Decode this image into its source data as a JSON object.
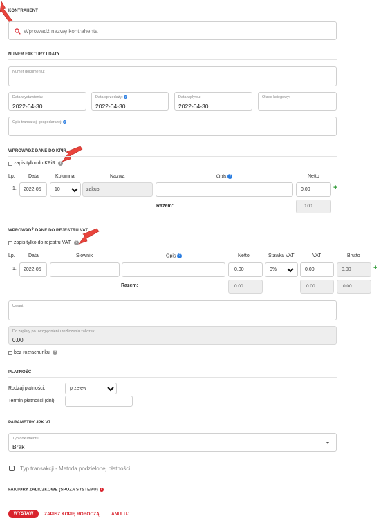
{
  "kontrahent": {
    "section": "KONTRAHENT",
    "search_placeholder": "Wprowadź nazwę kontrahenta"
  },
  "faktura": {
    "section": "NUMER FAKTURY I DATY",
    "numer_label": "Numer dokumentu:",
    "data_wystawienia_label": "Data wystawienia:",
    "data_wystawienia": "2022-04-30",
    "data_sprzedazy_label": "Data sprzedaży:",
    "data_sprzedazy": "2022-04-30",
    "data_wplywu_label": "Data wpływu:",
    "data_wplywu": "2022-04-30",
    "okres_label": "Okres księgowy:",
    "opis_label": "Opis transakcji gospodarczej:"
  },
  "kpir": {
    "section": "WPROWADŹ DANE DO KPIR",
    "checkbox_label": "zapis tylko do KPiR",
    "headers": {
      "lp": "Lp.",
      "data": "Data",
      "kolumna": "Kolumna",
      "nazwa": "Nazwa",
      "opis": "Opis",
      "netto": "Netto"
    },
    "row": {
      "lp": "1.",
      "data": "2022-05",
      "kolumna": "10",
      "nazwa": "zakup",
      "netto": "0.00"
    },
    "razem_label": "Razem:",
    "razem_netto": "0.00"
  },
  "vat": {
    "section": "WPROWADŹ DANE DO REJESTRU VAT",
    "checkbox_label": "zapis tylko do rejestru VAT",
    "headers": {
      "lp": "Lp.",
      "data": "Data",
      "slownik": "Słownik",
      "opis": "Opis",
      "netto": "Netto",
      "stawka": "Stawka VAT",
      "vat": "VAT",
      "brutto": "Brutto"
    },
    "row": {
      "lp": "1.",
      "data": "2022-05",
      "netto": "0.00",
      "stawka": "0%",
      "vat": "0.00",
      "brutto": "0.00"
    },
    "razem_label": "Razem:",
    "razem_netto": "0.00",
    "razem_vat": "0.00",
    "razem_brutto": "0.00"
  },
  "uwagi": {
    "label": "Uwagi:",
    "do_zaplaty_label": "Do zapłaty po uwzględnieniu rozliczenia zaliczek:",
    "do_zaplaty": "0.00",
    "bez_rozrachunku": "bez rozrachunku"
  },
  "platnosc": {
    "section": "PŁATNOŚĆ",
    "rodzaj_label": "Rodzaj płatności:",
    "rodzaj_value": "przelew",
    "termin_label": "Termin płatności (dni):"
  },
  "jpk": {
    "section": "PARAMETRY JPK V7",
    "typ_label": "Typ dokumentu",
    "typ_value": "Brak",
    "mpp_label": "Typ transakcji - Metoda podzielonej płatności"
  },
  "zaliczkowe": {
    "section": "FAKTURY ZALICZKOWE (SPOZA SYSTEMU)"
  },
  "actions": {
    "wystaw": "WYSTAW",
    "zapisz": "ZAPISZ KOPIĘ ROBOCZĄ",
    "anuluj": "ANULUJ"
  },
  "colors": {
    "accent_red": "#d9232d",
    "plus_green": "#2e9a36",
    "info_blue": "#2a7de1"
  },
  "icons": [
    "search-icon",
    "annotation-arrow-icon",
    "help-icon",
    "info-icon",
    "plus-icon",
    "chevron-down-icon",
    "arrow-right-circle-icon"
  ]
}
